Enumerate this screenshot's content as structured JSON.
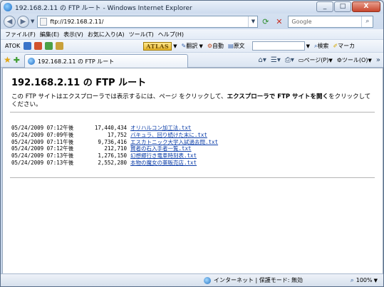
{
  "window": {
    "title": "192.168.2.11 の FTP ルート - Windows Internet Explorer",
    "minimize": "_",
    "maximize": "□",
    "close": "X"
  },
  "address": {
    "url": "ftp://192.168.2.11/",
    "search_placeholder": "Google"
  },
  "menu": [
    "ファイル(F)",
    "編集(E)",
    "表示(V)",
    "お気に入り(A)",
    "ツール(T)",
    "ヘルプ(H)"
  ],
  "atok": {
    "label": "ATOK",
    "logo": "ATLAS",
    "translate": "翻訳",
    "auto": "自動",
    "original": "原文",
    "search": "検索",
    "marker": "マーカ"
  },
  "tab": {
    "title": "192.168.2.11 の FTP ルート"
  },
  "commands": {
    "page": "ページ(P)",
    "tools": "ツール(O)"
  },
  "page": {
    "heading": "192.168.2.11 の FTP ルート",
    "desc_prefix": "この FTP サイトはエクスプローラでは表示するには、ページ をクリックして、",
    "desc_bold": "エクスプローラで FTP サイトを開く",
    "desc_suffix": "をクリックしてください。"
  },
  "files": [
    {
      "date": "05/24/2009 07:12午後",
      "size": "17,440,434",
      "name": "オリハルコン加工法.txt"
    },
    {
      "date": "05/24/2009 07:09午後",
      "size": "17,752",
      "name": "バキュラ、回り続けた末に.txt"
    },
    {
      "date": "05/24/2009 07:11午後",
      "size": "9,736,416",
      "name": "エスカトニック大学入試過去問.txt"
    },
    {
      "date": "05/24/2009 07:12午後",
      "size": "212,710",
      "name": "賢者の石入手者一覧.txt"
    },
    {
      "date": "05/24/2009 07:13午後",
      "size": "1,276,150",
      "name": "幻想郷行き電車時刻表.txt"
    },
    {
      "date": "05/24/2009 07:13午後",
      "size": "2,552,280",
      "name": "本物の魔女の薬販売店.txt"
    }
  ],
  "status": {
    "zone": "インターネット | 保護モード: 無効",
    "zoom": "100%"
  }
}
